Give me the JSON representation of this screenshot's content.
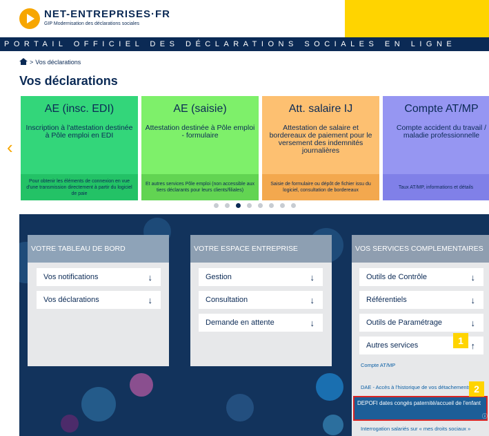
{
  "brand": {
    "name": "NET-ENTREPRISES·FR",
    "tagline": "GIP Modernisation des déclarations sociales",
    "banner": "PORTAIL OFFICIEL DES DÉCLARATIONS SOCIALES EN LIGNE"
  },
  "breadcrumb": {
    "icon": "home-icon",
    "separator": ">",
    "label": "Vos déclarations"
  },
  "page_title": "Vos déclarations",
  "carousel": {
    "prev_icon": "chevron-left-icon",
    "prev_glyph": "‹",
    "active_dot": 2,
    "dot_count": 8,
    "cards": [
      {
        "title": "AE (insc. EDI)",
        "description": "Inscription à l'attestation destinée à Pôle emploi en EDI",
        "footer": "Pour obtenir les éléments de connexion en vue d'une transmission directement à partir du logiciel de paie",
        "color": "#33d67a",
        "footer_color": "#23c266"
      },
      {
        "title": "AE (saisie)",
        "description": "Attestation destinée à Pôle emploi - formulaire",
        "footer": "Et autres services Pôle emploi (non accessible aux tiers déclarants pour leurs clients/filiales)",
        "color": "#7ef06a",
        "footer_color": "#62d452"
      },
      {
        "title": "Att. salaire IJ",
        "description": "Attestation de salaire et bordereaux de paiement pour le versement des indemnités journalières",
        "footer": "Saisie de formulaire ou dépôt de fichier issu du logiciel, consultation de bordereaux",
        "color": "#fdc071",
        "footer_color": "#f3a84e"
      },
      {
        "title": "Compte AT/MP",
        "description": "Compte accident du travail / maladie professionnelle",
        "footer": "Taux AT/MP, informations et détails",
        "color": "#9696f2",
        "footer_color": "#8080e8"
      }
    ]
  },
  "dashboard": {
    "title": "VOTRE TABLEAU DE BORD",
    "items": [
      {
        "label": "Vos notifications"
      },
      {
        "label": "Vos déclarations"
      }
    ]
  },
  "espace": {
    "title": "VOTRE ESPACE ENTREPRISE",
    "items": [
      {
        "label": "Gestion"
      },
      {
        "label": "Consultation"
      },
      {
        "label": "Demande en attente"
      }
    ]
  },
  "services": {
    "title": "VOS SERVICES COMPLEMENTAIRES",
    "items": [
      {
        "label": "Outils de Contrôle"
      },
      {
        "label": "Référentiels"
      },
      {
        "label": "Outils de Paramétrage"
      },
      {
        "label": "Autres services"
      }
    ],
    "sub_links": [
      {
        "label": "Compte AT/MP"
      },
      {
        "label": "DAE - Accès à l'historique de vos détachements"
      },
      {
        "label": "DEPOFI dates congés paternité/accueil de l'enfant"
      },
      {
        "label": "Interrogation salariés sur « mes droits sociaux »"
      }
    ]
  },
  "arrows": {
    "down": "↓",
    "up": "↑",
    "info": "ⓘ"
  },
  "markers": {
    "first": "1",
    "second": "2"
  },
  "colors": {
    "navy": "#0b2a55",
    "accent": "#ffd400",
    "orange": "#f7a600",
    "highlight_border": "#d82424"
  }
}
